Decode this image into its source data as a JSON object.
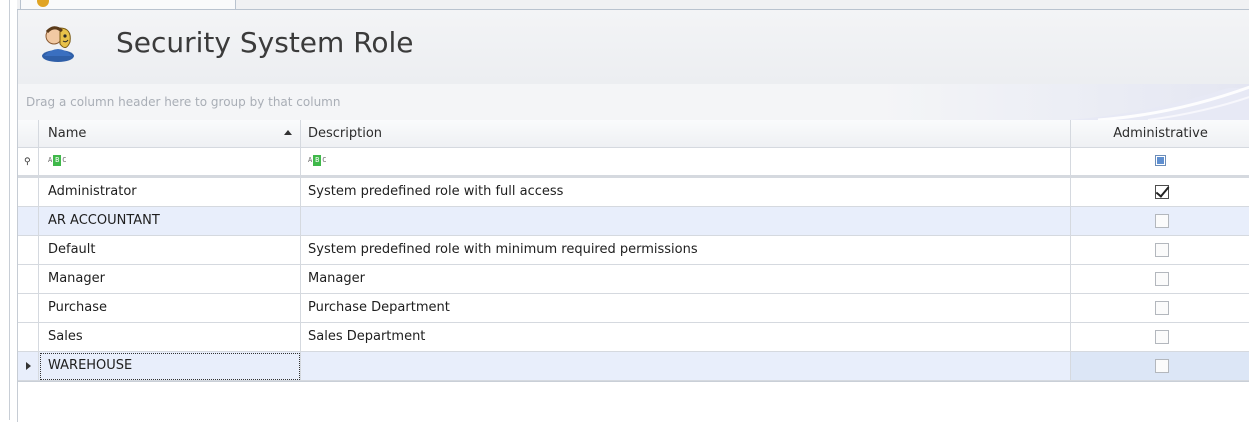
{
  "page": {
    "title": "Security System Role"
  },
  "group_panel": {
    "hint": "Drag a column header here to group by that column"
  },
  "columns": {
    "name": "Name",
    "description": "Description",
    "administrative": "Administrative"
  },
  "rows": [
    {
      "name": "Administrator",
      "description": "System predefined role with full access",
      "administrative": true
    },
    {
      "name": "AR ACCOUNTANT",
      "description": "",
      "administrative": false
    },
    {
      "name": "Default",
      "description": "System predefined role with minimum required permissions",
      "administrative": false
    },
    {
      "name": "Manager",
      "description": "Manager",
      "administrative": false
    },
    {
      "name": "Purchase",
      "description": "Purchase Department",
      "administrative": false
    },
    {
      "name": "Sales",
      "description": "Sales Department",
      "administrative": false
    },
    {
      "name": "WAREHOUSE",
      "description": "",
      "administrative": false
    }
  ],
  "focused_row": "WAREHOUSE",
  "sort": {
    "column": "Name",
    "direction": "ascending"
  },
  "icons": {
    "title": "security-role-icon",
    "filter_row": "pin-icon",
    "filter_text": "abc-filter-icon",
    "sort": "sort-ascending-icon",
    "row_indicator": "row-indicator-icon"
  },
  "colors": {
    "alt_row": "#e8eefb",
    "check_accent": "#5f8fd0",
    "filter_green": "#3fb84a"
  }
}
